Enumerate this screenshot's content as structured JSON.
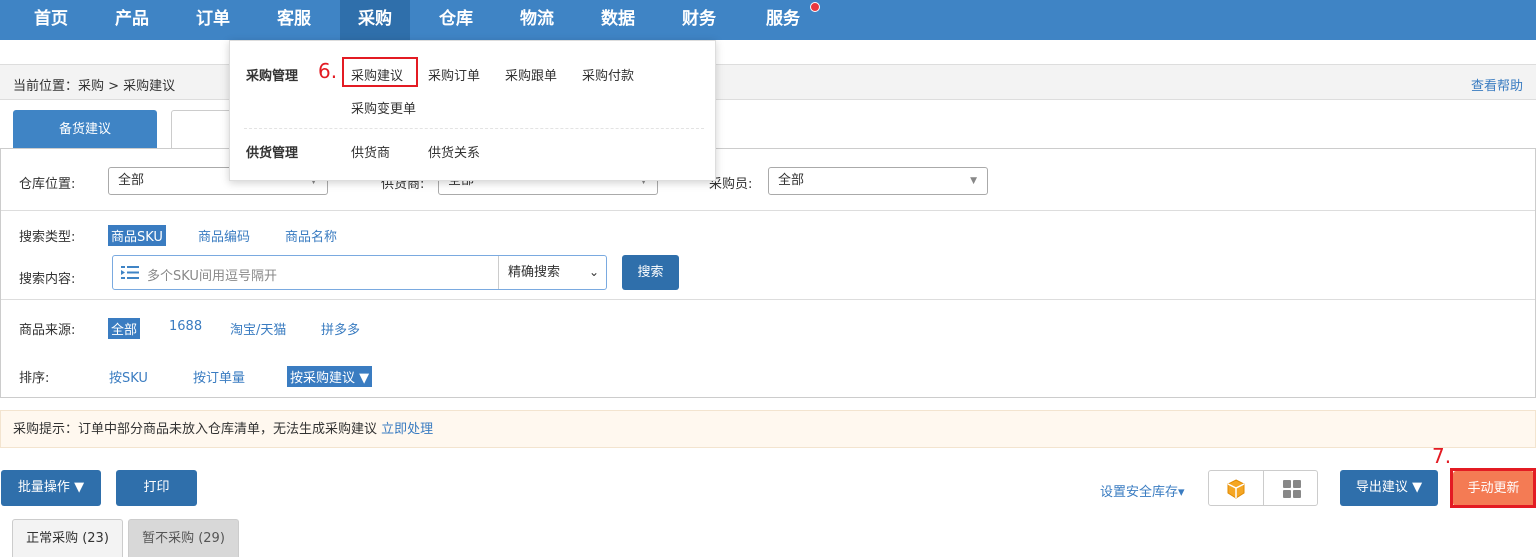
{
  "nav": {
    "items": [
      {
        "label": "首页"
      },
      {
        "label": "产品"
      },
      {
        "label": "订单"
      },
      {
        "label": "客服"
      },
      {
        "label": "采购"
      },
      {
        "label": "仓库"
      },
      {
        "label": "物流"
      },
      {
        "label": "数据"
      },
      {
        "label": "财务"
      },
      {
        "label": "服务"
      }
    ],
    "active": "采购",
    "colors": {
      "bar": "#3f84c5",
      "active": "#2f6fab",
      "badge": "#e9383f"
    }
  },
  "breadcrumb": {
    "text": "当前位置：采购 > 采购建议",
    "help": "查看帮助"
  },
  "tabs": [
    {
      "label": "备货建议"
    },
    {
      "label": "缺"
    }
  ],
  "filters": {
    "warehouse_label": "仓库位置:",
    "warehouse_value": "全部",
    "supplier_label": "供货商:",
    "supplier_value": "全部",
    "buyer_label": "采购员:",
    "buyer_value": "全部",
    "search_type_label": "搜索类型:",
    "search_types": [
      "商品SKU",
      "商品编码",
      "商品名称"
    ],
    "search_content_label": "搜索内容:",
    "search_placeholder": "多个SKU间用逗号隔开",
    "search_mode": "精确搜索",
    "search_button": "搜索",
    "source_label": "商品来源:",
    "sources": [
      "全部",
      "1688",
      "淘宝/天猫",
      "拼多多"
    ],
    "sort_label": "排序:",
    "sorts": [
      "按SKU",
      "按订单量",
      "按采购建议"
    ]
  },
  "notice": {
    "text": "采购提示：订单中部分商品未放入仓库清单，无法生成采购建议",
    "action": "立即处理"
  },
  "toolbar": {
    "batch": "批量操作",
    "print": "打印",
    "safety_stock": "设置安全库存",
    "export": "导出建议",
    "manual_update": "手动更新"
  },
  "bottom_tabs": [
    {
      "label": "正常采购 (23)"
    },
    {
      "label": "暂不采购 (29)"
    }
  ],
  "dropdown": {
    "purchase_mgmt": "采购管理",
    "purchase_items": [
      "采购建议",
      "采购订单",
      "采购跟单",
      "采购付款",
      "采购变更单"
    ],
    "supply_mgmt": "供货管理",
    "supply_items": [
      "供货商",
      "供货关系"
    ]
  },
  "annotations": {
    "step6": "6.",
    "step7": "7.",
    "color": "#e31b23"
  }
}
